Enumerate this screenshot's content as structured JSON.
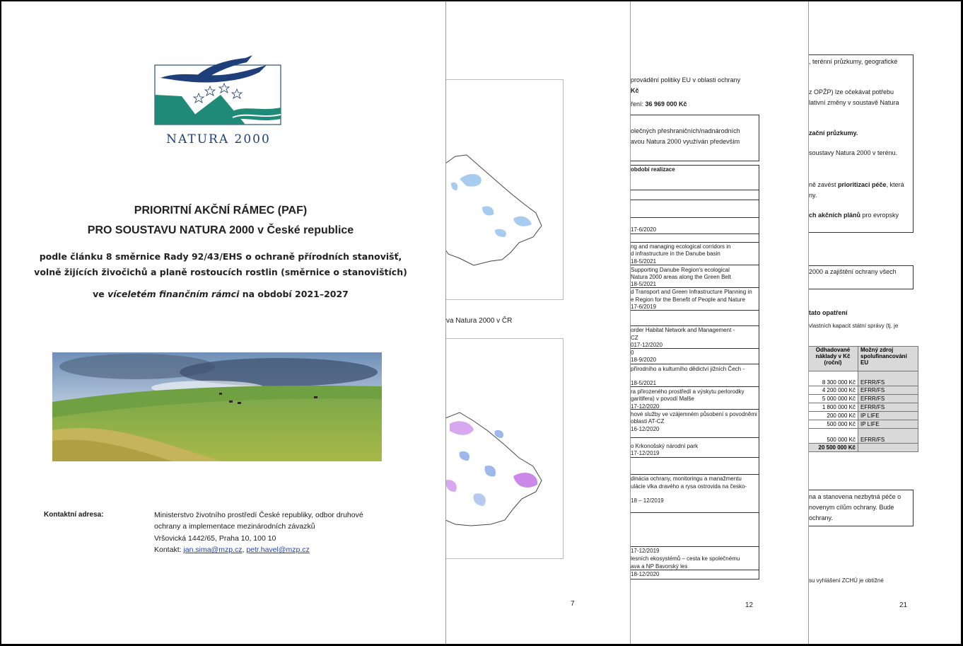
{
  "page1": {
    "logo_text": "NATURA 2000",
    "title_line1": "PRIORITNÍ AKČNÍ RÁMEC (PAF)",
    "title_line2": "PRO SOUSTAVU NATURA 2000 v České republice",
    "subtitle_line1": "podle článku 8 směrnice Rady 92/43/EHS o ochraně přírodních stanovišť,",
    "subtitle_line2": "volně žijících živočichů a planě rostoucích rostlin (směrnice o stanovištích)",
    "subtitle_line3_pre": "ve ",
    "subtitle_line3_italic": "víceletém finančním rámci",
    "subtitle_line3_post": " na období 2021–2027",
    "contact_label": "Kontaktní adresa:",
    "contact_line1": "Ministerstvo životního prostředí České republiky, odbor druhové",
    "contact_line2": "ochrany a implementace mezinárodních závazků",
    "contact_line3": "Vršovická 1442/65, Praha 10, 100 10",
    "contact_prefix": "Kontakt: ",
    "email1": "jan.sima@mzp.cz",
    "email_sep": ", ",
    "email2": "petr.havel@mzp.cz"
  },
  "page2": {
    "caption": "va Natura 2000 v ČR",
    "page_number": "7"
  },
  "page3": {
    "line1": "provádění politiky EU v oblasti ochrany",
    "line2": "Kč",
    "line3_pre": "ření: ",
    "line3_bold": "36 969 000 Kč",
    "box1_line1": "olečných přeshraničních/nadnárodních",
    "box1_line2": "avou Natura 2000 využíván především",
    "table_header": "období realizace",
    "rows": [
      "17-6/2020",
      "ng and managing ecological corridors in",
      "d infrastructure in the Danube basin",
      "18-5/2021",
      "Supporting Danube Region's ecological",
      "Natura 2000 areas along the Green Belt",
      "18-5/2021",
      "d Transport and Green Infrastructure Planning in",
      "e Region for the Benefit of People and Nature",
      "17-6/2019",
      "order Habitat Network and Management -",
      "CZ",
      "017-12/2020",
      "0",
      "18-9/2020",
      "přírodního a kulturního dědictví jižních Čech -",
      "18-5/2021",
      "ra přirozeného prostředí a výskytu perlorodky",
      "garitifera) v povodí Malše",
      "17-12/2020",
      "hové služby ve vzájemném působení s povodněmi",
      "oblasti AT-CZ",
      "16-12/2020",
      "o Krkonošský národní park",
      "17-12/2019",
      "dinácia ochrany, monitoringu a manažmentu",
      "ulácie vlka dravého a rysa ostrovida na česko-",
      "18 – 12/2019",
      "17-12/2019",
      "lesních ekosystémů – cesta ke společnému",
      "ava a NP Bavorský les",
      "18-12/2020"
    ],
    "page_number": "12"
  },
  "page4": {
    "l1": ", terénní průzkumy, geografické",
    "l2": "z OPŽP) lze očekávat potřebu",
    "l3": "lativní změny v soustavě Natura",
    "l4": "zační průzkumy.",
    "l5": "soustavy Natura 2000 v terénu.",
    "l6_pre": "ně zavést ",
    "l6_bold": "prioritizaci péče",
    "l6_post": ", která",
    "l7": "ny.",
    "l8_bold": "ch akčních plánů",
    "l8_post": " pro evropsky",
    "l9": " 2000 a zajištění ochrany všech",
    "l10": "tato opatření",
    "l11": "vlastních kapacit státní správy (tj. je",
    "table": {
      "header_cost": "Odhadované náklady v Kč (roční)",
      "header_source": "Možný zdroj spolufinancování EU",
      "rows": [
        {
          "cost": "8 300 000 Kč",
          "source": "EFRR/FS"
        },
        {
          "cost": "4 200 000 Kč",
          "source": "EFRR/FS"
        },
        {
          "cost": "5 000 000 Kč",
          "source": "EFRR/FS"
        },
        {
          "cost": "1 800 000 Kč",
          "source": "EFRR/FS"
        },
        {
          "cost": "200 000 Kč",
          "source": "IP LIFE"
        },
        {
          "cost": "500 000 Kč",
          "source": "IP LIFE"
        },
        {
          "cost": "500 000 Kč",
          "source": "EFRR/FS"
        }
      ],
      "total": "20 500 000 Kč"
    },
    "l12": "na a stanovena nezbytná péče o",
    "l13": "novenym cílům ochrany. Bude",
    "l14": "ochrany.",
    "l15": "su vyhlášení ZCHÚ je obtížné",
    "page_number": "21"
  }
}
